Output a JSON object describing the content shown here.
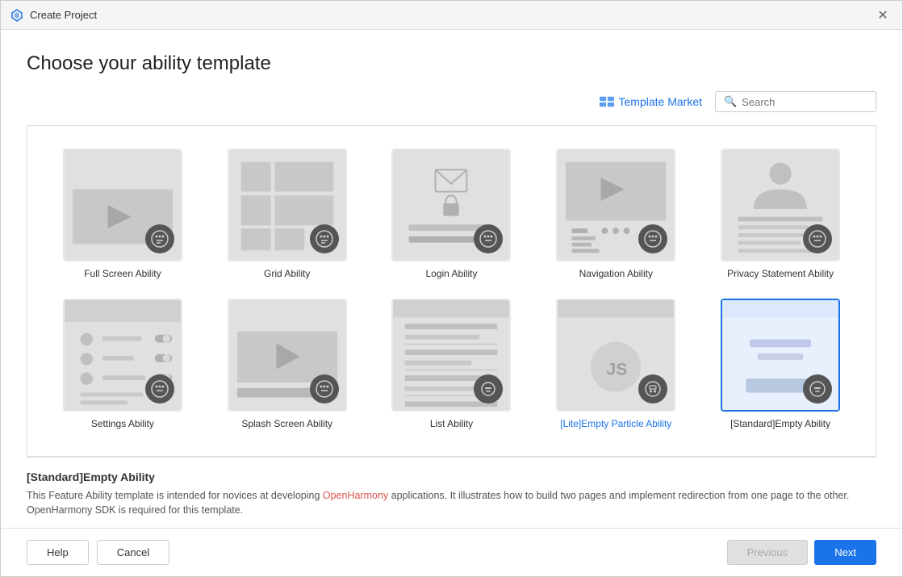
{
  "window": {
    "title": "Create Project",
    "close_label": "✕"
  },
  "page": {
    "title": "Choose your ability template"
  },
  "toolbar": {
    "template_market_label": "Template Market",
    "search_placeholder": "Search"
  },
  "templates": [
    {
      "id": "full-screen",
      "label": "Full Screen Ability",
      "selected": false,
      "blue_label": false,
      "badge": "grid"
    },
    {
      "id": "grid",
      "label": "Grid Ability",
      "selected": false,
      "blue_label": false,
      "badge": "grid"
    },
    {
      "id": "login",
      "label": "Login Ability",
      "selected": false,
      "blue_label": false,
      "badge": "grid"
    },
    {
      "id": "navigation",
      "label": "Navigation Ability",
      "selected": false,
      "blue_label": false,
      "badge": "grid"
    },
    {
      "id": "privacy",
      "label": "Privacy Statement Ability",
      "selected": false,
      "blue_label": false,
      "badge": "grid"
    },
    {
      "id": "settings",
      "label": "Settings Ability",
      "selected": false,
      "blue_label": false,
      "badge": "grid"
    },
    {
      "id": "splash",
      "label": "Splash Screen Ability",
      "selected": false,
      "blue_label": false,
      "badge": "grid"
    },
    {
      "id": "list",
      "label": "List Ability",
      "selected": false,
      "blue_label": false,
      "badge": "phone"
    },
    {
      "id": "lite-empty-particle",
      "label": "[Lite]Empty Particle Ability",
      "selected": false,
      "blue_label": true,
      "badge": "router"
    },
    {
      "id": "standard-empty",
      "label": "[Standard]Empty Ability",
      "selected": true,
      "blue_label": false,
      "badge": "phone"
    }
  ],
  "selected_template": {
    "title": "[Standard]Empty Ability",
    "description_parts": [
      "This Feature Ability template is intended for novices at developing ",
      "OpenHarmony",
      " applications. It illustrates how to build two pages and implement redirection from one page to the other. OpenHarmony SDK is required for this template."
    ]
  },
  "footer": {
    "help_label": "Help",
    "cancel_label": "Cancel",
    "previous_label": "Previous",
    "next_label": "Next"
  }
}
